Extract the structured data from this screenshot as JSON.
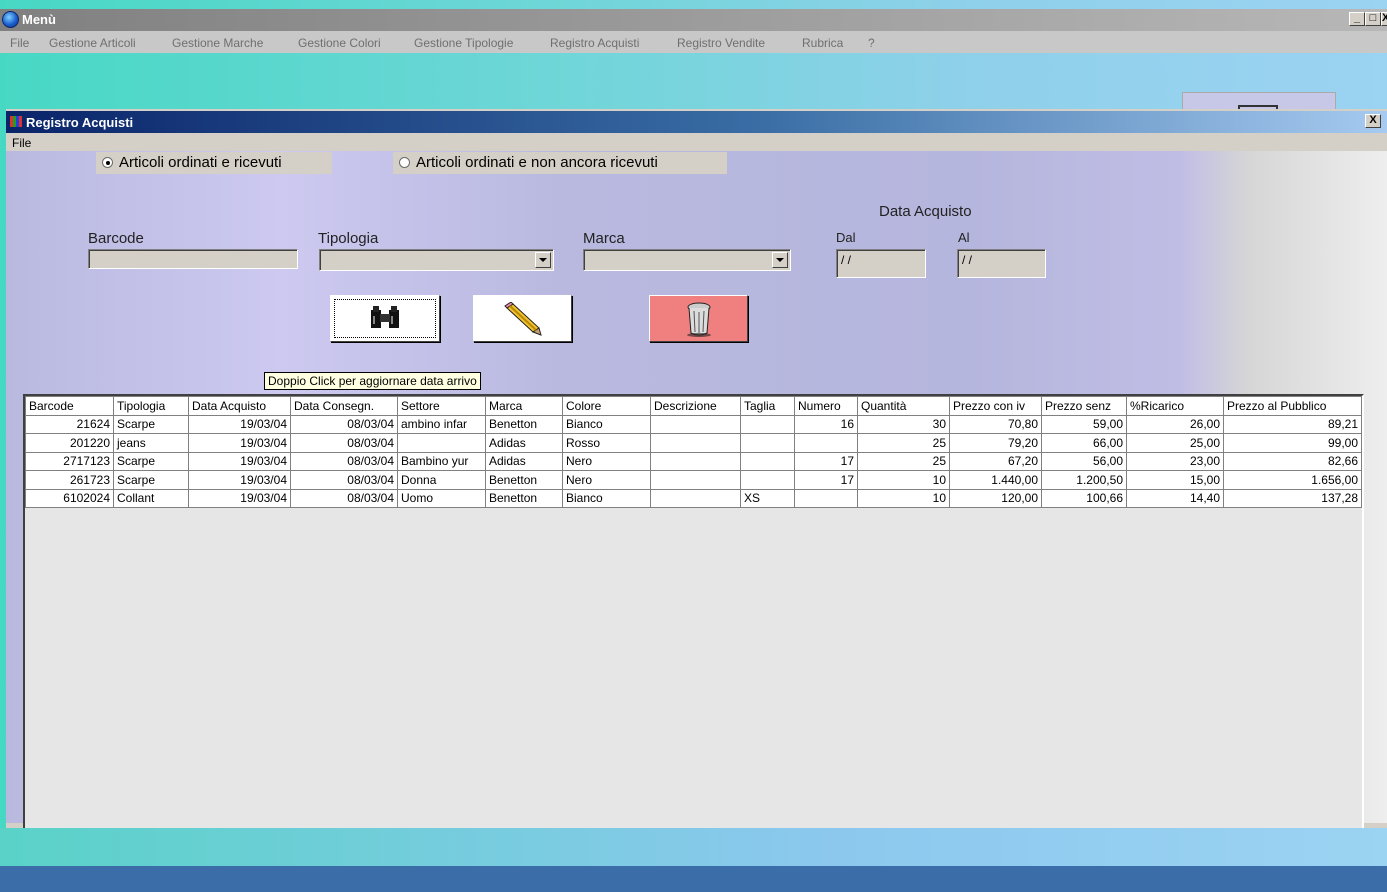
{
  "main_window": {
    "title": "Menù",
    "controls": [
      "_",
      "□",
      "X"
    ],
    "menu": [
      "File",
      "Gestione Articoli",
      "Gestione Marche",
      "Gestione Colori",
      "Gestione Tipologie",
      "Registro Acquisti",
      "Registro Vendite",
      "Rubrica",
      "?"
    ]
  },
  "child_window": {
    "title": "Registro Acquisti",
    "close": "X",
    "menu": [
      "File"
    ]
  },
  "filters": {
    "radio_received": "Articoli ordinati e ricevuti",
    "radio_not_received": "Articoli ordinati e non ancora ricevuti",
    "barcode_label": "Barcode",
    "tipologia_label": "Tipologia",
    "marca_label": "Marca",
    "data_acquisto_label": "Data Acquisto",
    "dal_label": "Dal",
    "al_label": "Al",
    "dal_value": "/ /",
    "al_value": "/ /"
  },
  "grid": {
    "columns": [
      "Barcode",
      "Tipologia",
      "Data Acquisto",
      "Data Consegn.",
      "Settore",
      "Marca",
      "Colore",
      "Descrizione",
      "Taglia",
      "Numero",
      "Quantità",
      "Prezzo con iv",
      "Prezzo senz",
      "%Ricarico",
      "Prezzo al Pubblico"
    ],
    "rows": [
      [
        "21624",
        "Scarpe",
        "19/03/04",
        "08/03/04",
        "ambino infar",
        "Benetton",
        "Bianco",
        "",
        "",
        "16",
        "30",
        "70,80",
        "59,00",
        "26,00",
        "89,21"
      ],
      [
        "201220",
        "jeans",
        "19/03/04",
        "08/03/04",
        "",
        "Adidas",
        "Rosso",
        "",
        "",
        "",
        "25",
        "79,20",
        "66,00",
        "25,00",
        "99,00"
      ],
      [
        "2717123",
        "Scarpe",
        "19/03/04",
        "08/03/04",
        "Bambino yur",
        "Adidas",
        "Nero",
        "",
        "",
        "17",
        "25",
        "67,20",
        "56,00",
        "23,00",
        "82,66"
      ],
      [
        "261723",
        "Scarpe",
        "19/03/04",
        "08/03/04",
        "Donna",
        "Benetton",
        "Nero",
        "",
        "",
        "17",
        "10",
        "1.440,00",
        "1.200,50",
        "15,00",
        "1.656,00"
      ],
      [
        "6102024",
        "Collant",
        "19/03/04",
        "08/03/04",
        "Uomo",
        "Benetton",
        "Bianco",
        "",
        "XS",
        "",
        "10",
        "120,00",
        "100,66",
        "14,40",
        "137,28"
      ]
    ]
  },
  "tooltip": "Doppio Click per aggiornare data arrivo",
  "icons": {
    "search": "binoculars-icon",
    "edit": "pencil-icon",
    "delete": "trash-icon"
  },
  "colors": {
    "delete_button": "#f08080",
    "child_titlebar": "#0a246a"
  }
}
